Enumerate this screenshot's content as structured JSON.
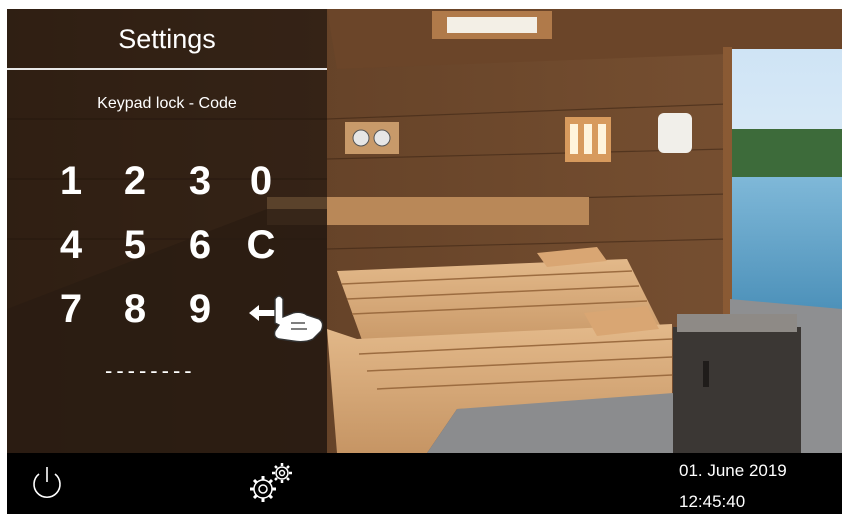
{
  "header": {
    "title": "Settings"
  },
  "keypad": {
    "subtitle": "Keypad lock - Code",
    "keys": [
      "1",
      "2",
      "3",
      "0",
      "4",
      "5",
      "6",
      "C",
      "7",
      "8",
      "9"
    ],
    "code_placeholder": "--------"
  },
  "icons": {
    "backspace": "backspace-hand-icon",
    "power": "power-icon",
    "settings": "gears-icon"
  },
  "status": {
    "date": "01. June 2019",
    "time": "12:45:40"
  },
  "colors": {
    "overlay": "#0c0a08",
    "text": "#ffffff",
    "bar": "#000000"
  }
}
